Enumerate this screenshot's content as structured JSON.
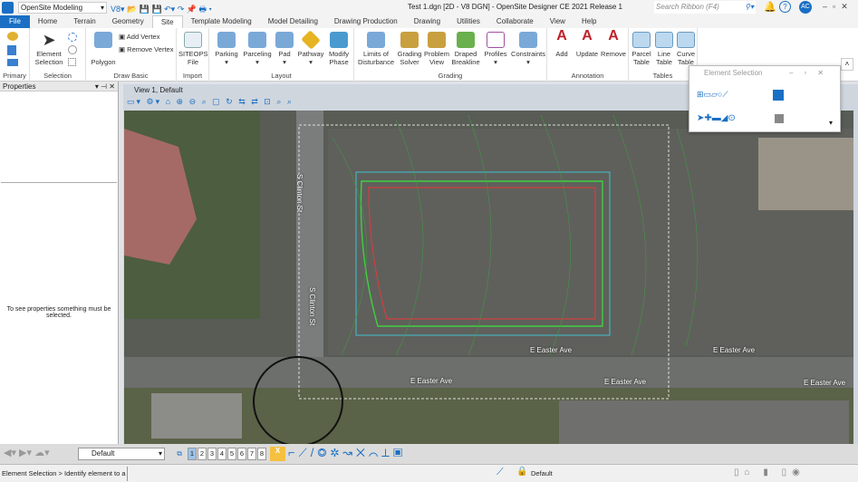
{
  "titlebar": {
    "workflow": "OpenSite Modeling",
    "title": "Test 1.dgn [2D - V8 DGN] - OpenSite Designer CE 2021 Release 1",
    "search_placeholder": "Search Ribbon (F4)",
    "user_initials": "AC"
  },
  "tabs": [
    "File",
    "Home",
    "Terrain",
    "Geometry",
    "Site",
    "Template Modeling",
    "Model Detailing",
    "Drawing Production",
    "Drawing",
    "Utilities",
    "Collaborate",
    "View",
    "Help"
  ],
  "active_tab": "Site",
  "ribbon": {
    "groups": [
      {
        "label": "Primary"
      },
      {
        "label": "Selection",
        "buttons": [
          "Element Selection"
        ]
      },
      {
        "label": "Draw Basic",
        "buttons": [
          "Polygon",
          "Add Vertex",
          "Remove Vertex"
        ]
      },
      {
        "label": "Import",
        "buttons": [
          "SITEOPS File"
        ]
      },
      {
        "label": "Layout",
        "buttons": [
          "Parking",
          "Parceling",
          "Pad",
          "Pathway",
          "Modify Phase"
        ]
      },
      {
        "label": "Grading",
        "buttons": [
          "Limits of Disturbance",
          "Grading Solver",
          "Problem View",
          "Draped Breakline",
          "Profiles",
          "Constraints"
        ]
      },
      {
        "label": "Annotation",
        "buttons": [
          "Add",
          "Update",
          "Remove"
        ]
      },
      {
        "label": "Tables",
        "buttons": [
          "Parcel Table",
          "Line Table",
          "Curve Table"
        ]
      }
    ]
  },
  "properties": {
    "title": "Properties",
    "empty_message": "To see properties something must be selected."
  },
  "view": {
    "title": "View 1, Default"
  },
  "map": {
    "streets": [
      "S Clinton St",
      "S Clinton St",
      "E Easter Ave",
      "E Easter Ave",
      "E Easter Ave",
      "E Easter Ave",
      "E Easter Ave"
    ]
  },
  "element_selection_dialog": {
    "title": "Element Selection"
  },
  "bottombar": {
    "model": "Default",
    "views": [
      "1",
      "2",
      "3",
      "4",
      "5",
      "6",
      "7",
      "8"
    ],
    "active_view": "1"
  },
  "status": {
    "prompt": "Element Selection > Identify element to a",
    "level": "Default"
  },
  "colors": {
    "accent": "#1a6fc4"
  }
}
